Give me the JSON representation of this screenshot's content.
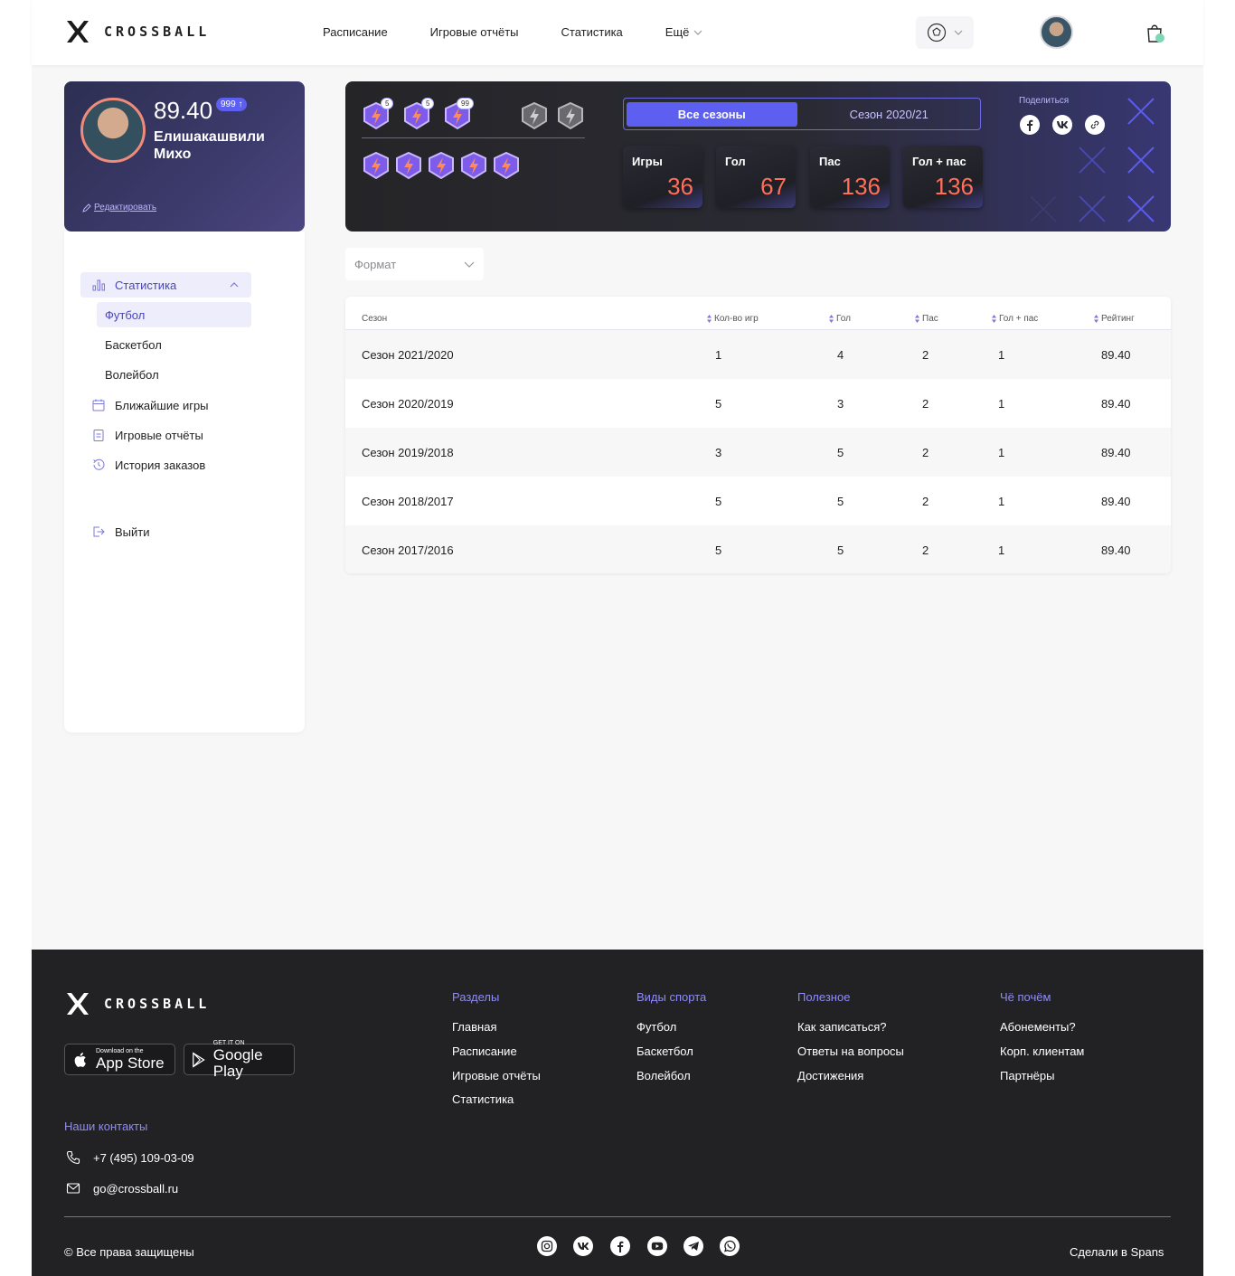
{
  "header": {
    "brand": "CROSSBALL",
    "nav": [
      "Расписание",
      "Игровые отчёты",
      "Статистика",
      "Ещё"
    ]
  },
  "profile": {
    "rating": "89.40",
    "rating_badge": "999 ↑",
    "name": "Елишакашвили Михо",
    "edit_label": "Редактировать"
  },
  "sidebar": {
    "items": [
      {
        "label": "Статистика",
        "icon": "chart-icon"
      },
      {
        "label": "Футбол"
      },
      {
        "label": "Баскетбол"
      },
      {
        "label": "Волейбол"
      },
      {
        "label": "Ближайшие игры",
        "icon": "calendar-icon"
      },
      {
        "label": "Игровые отчёты",
        "icon": "clipboard-icon"
      },
      {
        "label": "История заказов",
        "icon": "history-icon"
      },
      {
        "label": "Выйти",
        "icon": "logout-icon"
      }
    ]
  },
  "banner": {
    "badge_counts": [
      "5",
      "5",
      "99"
    ],
    "season_tabs": [
      "Все сезоны",
      "Сезон 2020/21"
    ],
    "stats": [
      {
        "label": "Игры",
        "value": "36"
      },
      {
        "label": "Гол",
        "value": "67"
      },
      {
        "label": "Пас",
        "value": "136"
      },
      {
        "label": "Гол + пас",
        "value": "136"
      }
    ],
    "share_label": "Поделиться"
  },
  "format": {
    "label": "Формат"
  },
  "table": {
    "headers": [
      "Сезон",
      "Кол-во игр",
      "Гол",
      "Пас",
      "Гол + пас",
      "Рейтинг"
    ],
    "rows": [
      [
        "Сезон 2021/2020",
        "1",
        "4",
        "2",
        "1",
        "89.40"
      ],
      [
        "Сезон 2020/2019",
        "5",
        "3",
        "2",
        "1",
        "89.40"
      ],
      [
        "Сезон 2019/2018",
        "3",
        "5",
        "2",
        "1",
        "89.40"
      ],
      [
        "Сезон 2018/2017",
        "5",
        "5",
        "2",
        "1",
        "89.40"
      ],
      [
        "Сезон 2017/2016",
        "5",
        "5",
        "2",
        "1",
        "89.40"
      ]
    ]
  },
  "footer": {
    "brand": "CROSSBALL",
    "app_store": {
      "small": "Download on the",
      "big": "App Store"
    },
    "google_play": {
      "small": "GET IT ON",
      "big": "Google Play"
    },
    "columns": [
      {
        "title": "Разделы",
        "links": [
          "Главная",
          "Расписание",
          "Игровые отчёты",
          "Статистика"
        ]
      },
      {
        "title": "Виды спорта",
        "links": [
          "Футбол",
          "Баскетбол",
          "Волейбол"
        ]
      },
      {
        "title": "Полезное",
        "links": [
          "Как записаться?",
          "Ответы на вопросы",
          "Достижения"
        ]
      },
      {
        "title": "Чё почём",
        "links": [
          "Абонементы?",
          "Корп. клиентам",
          "Партнёры"
        ]
      }
    ],
    "contacts_title": "Наши контакты",
    "phone": "+7 (495) 109-03-09",
    "email": "go@crossball.ru",
    "copyright": "© Все права защищены",
    "made_by": "Сделали в Spans"
  },
  "colors": {
    "accent": "#5d5ff0",
    "stat_value": "#ff6f5a",
    "footer_bg": "#222224"
  }
}
